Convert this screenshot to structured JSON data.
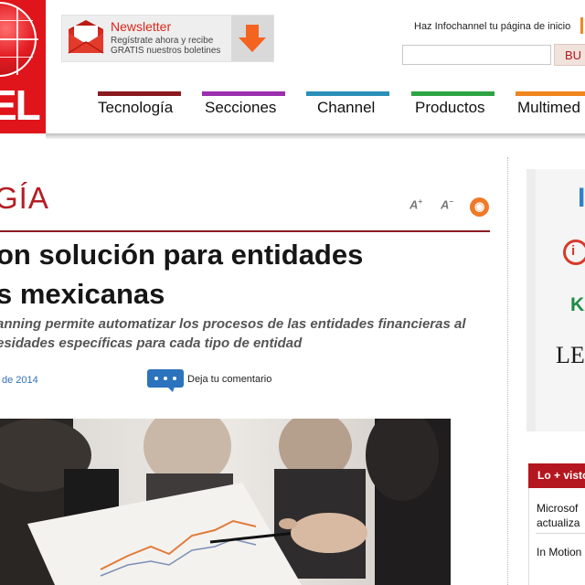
{
  "header": {
    "newsletter": {
      "title": "Newsletter",
      "text": "Regístrate ahora y recibe GRATIS nuestros boletines"
    },
    "home_link": "Haz Infochannel tu página de inicio",
    "search": {
      "placeholder": "",
      "button": "BU"
    },
    "nav": [
      {
        "label": "Tecnología",
        "color": "#8b1a1f"
      },
      {
        "label": "Secciones",
        "color": "#9b2fae"
      },
      {
        "label": "Channel",
        "color": "#2b8fb8"
      },
      {
        "label": "Productos",
        "color": "#2ea543"
      },
      {
        "label": "Multimed",
        "color": "#f0841e"
      }
    ],
    "brand_color": "#e0141b"
  },
  "article": {
    "section": "GÍA",
    "headline_line1": "on solución para entidades",
    "headline_line2": "s mexicanas",
    "subhead_line1": "anning permite automatizar los procesos de las entidades financieras al",
    "subhead_line2": "esidades específicas para cada tipo de entidad",
    "date": "de 2014",
    "comment_label": "Deja tu comentario"
  },
  "sidebar": {
    "sponsor_initials": [
      "I",
      "i",
      "KA",
      "LEX"
    ],
    "most_read": {
      "title": "Lo + visto",
      "items": [
        {
          "line1": "Microsof",
          "line2": "actualiza"
        },
        {
          "line1": "In Motion",
          "line2": ""
        }
      ]
    }
  }
}
